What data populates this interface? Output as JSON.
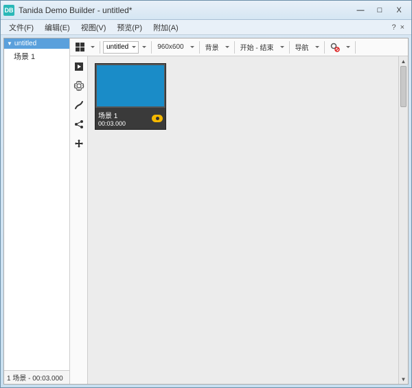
{
  "window": {
    "app_icon_text": "DB",
    "title": "Tanida Demo Builder - untitled*"
  },
  "menubar": {
    "items": [
      "文件(F)",
      "编辑(E)",
      "视图(V)",
      "预览(P)",
      "附加(A)"
    ],
    "help": "?",
    "minimize": "×"
  },
  "win_controls": {
    "minimize": "—",
    "maximize": "□",
    "close": "X"
  },
  "sidebar": {
    "header": "untitled",
    "items": [
      "场景 1"
    ]
  },
  "status": "1 场景 - 00:03.000",
  "toolbar": {
    "file_select": "untitled",
    "size": "960x600",
    "bg_label": "背景",
    "range_label": "开始 - 结束",
    "nav_label": "导航"
  },
  "scene": {
    "name": "场景 1",
    "time": "00:03.000"
  }
}
